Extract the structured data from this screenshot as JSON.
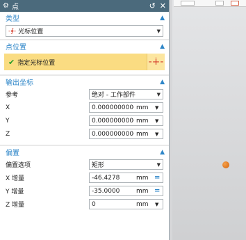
{
  "window": {
    "title": "点",
    "title_icon": "gear-icon",
    "reset_glyph": "↺",
    "close_glyph": "✕"
  },
  "sections": {
    "type": {
      "header": "类型",
      "selected": "光标位置",
      "icon": "crosshair-icon"
    },
    "point_location": {
      "header": "点位置",
      "specify_label": "指定光标位置",
      "status_icon": "check-icon"
    },
    "output_coords": {
      "header": "输出坐标",
      "reference_label": "参考",
      "reference_value": "绝对 - 工作部件",
      "x_label": "X",
      "x_value": "0.000000000(",
      "x_unit": "mm",
      "y_label": "Y",
      "y_value": "0.000000000(",
      "y_unit": "mm",
      "z_label": "Z",
      "z_value": "0.000000000(",
      "z_unit": "mm"
    },
    "offset": {
      "header": "偏置",
      "option_label": "偏置选项",
      "option_value": "矩形",
      "dx_label": "X 增量",
      "dx_value": "-46.4278",
      "dx_unit": "mm",
      "dy_label": "Y 增量",
      "dy_value": "-35.0000",
      "dy_unit": "mm",
      "dz_label": "Z 增量",
      "dz_value": "0",
      "dz_unit": "mm"
    }
  },
  "colors": {
    "titlebar": "#4b6a7c",
    "section_header_text": "#2e86c8",
    "highlight_row": "#fadc82",
    "marker": "#e07a1c"
  }
}
